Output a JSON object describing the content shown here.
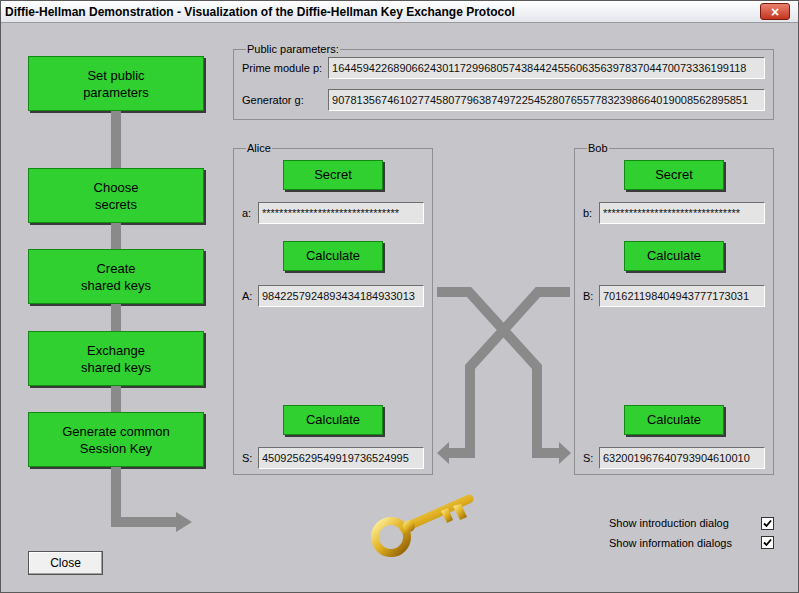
{
  "window": {
    "title": "Diffie-Hellman Demonstration - Visualization of the Diffie-Hellman Key Exchange Protocol",
    "close": "×"
  },
  "steps": [
    {
      "lines": [
        "Set public",
        "parameters"
      ]
    },
    {
      "lines": [
        "Choose",
        "secrets"
      ]
    },
    {
      "lines": [
        "Create",
        "shared keys"
      ]
    },
    {
      "lines": [
        "Exchange",
        "shared keys"
      ]
    },
    {
      "lines": [
        "Generate common",
        "Session Key"
      ]
    }
  ],
  "public_parameters": {
    "title": "Public parameters:",
    "fields": [
      {
        "label": "Prime module p:",
        "value": "16445942268906624301172996805743844245560635639783704470073336199118"
      },
      {
        "label": "Generator g:",
        "value": "90781356746102774580779638749722545280765577832398664019008562895851"
      }
    ]
  },
  "parties": [
    {
      "name": "Alice",
      "secret_button": "Secret",
      "secret_label": "a:",
      "secret_value": "********************************",
      "public_button": "Calculate",
      "public_label": "A:",
      "public_value": "9842257924893434184933013",
      "session_button": "Calculate",
      "session_label": "S:",
      "session_value": "450925629549919736524995"
    },
    {
      "name": "Bob",
      "secret_button": "Secret",
      "secret_label": "b:",
      "secret_value": "********************************",
      "public_button": "Calculate",
      "public_label": "B:",
      "public_value": "701621198404943777173031",
      "session_button": "Calculate",
      "session_label": "S:",
      "session_value": "632001967640793904610010"
    }
  ],
  "buttons": [
    "Close"
  ],
  "options": [
    {
      "label": "Show introduction dialog",
      "checked": true
    },
    {
      "label": "Show information dialogs",
      "checked": true
    }
  ]
}
